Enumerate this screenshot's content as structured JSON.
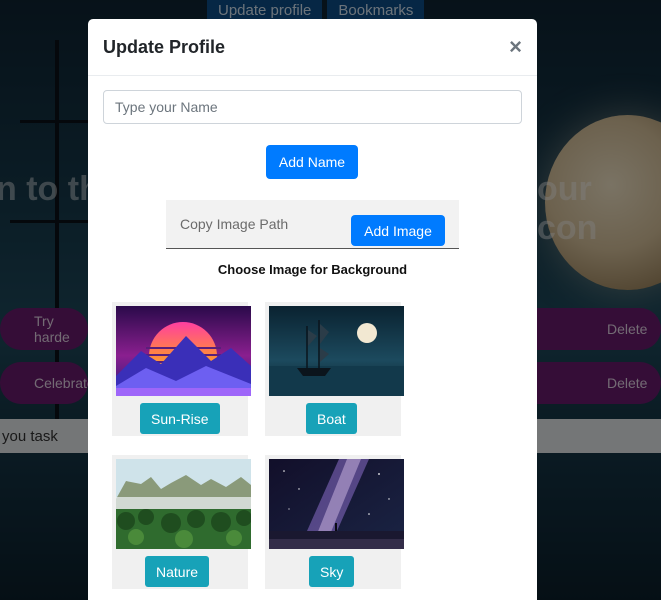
{
  "background_page": {
    "nav": [
      "Update profile",
      "Bookmarks"
    ],
    "heading_left": "n to th",
    "heading_right": "our con",
    "tasks": [
      {
        "text": "Try harde",
        "delete_label": "Delete"
      },
      {
        "text": "Celebrate",
        "delete_label": "Delete"
      }
    ],
    "task_input_text": "you task"
  },
  "modal": {
    "title": "Update Profile",
    "close_label": "×",
    "name_input": {
      "placeholder": "Type your Name",
      "value": ""
    },
    "add_name_label": "Add Name",
    "image_path_input": {
      "placeholder": "Copy Image Path",
      "value": ""
    },
    "add_image_label": "Add Image",
    "choose_label": "Choose Image for Background",
    "images": [
      {
        "label": "Sun-Rise",
        "icon": "sunrise-thumbnail"
      },
      {
        "label": "Boat",
        "icon": "boat-thumbnail"
      },
      {
        "label": "Nature",
        "icon": "nature-thumbnail"
      },
      {
        "label": "Sky",
        "icon": "sky-thumbnail"
      }
    ]
  },
  "colors": {
    "primary": "#007bff",
    "info": "#17a2b8",
    "task_pill": "#6b1a6e",
    "nav_button": "#0d4f8b"
  }
}
